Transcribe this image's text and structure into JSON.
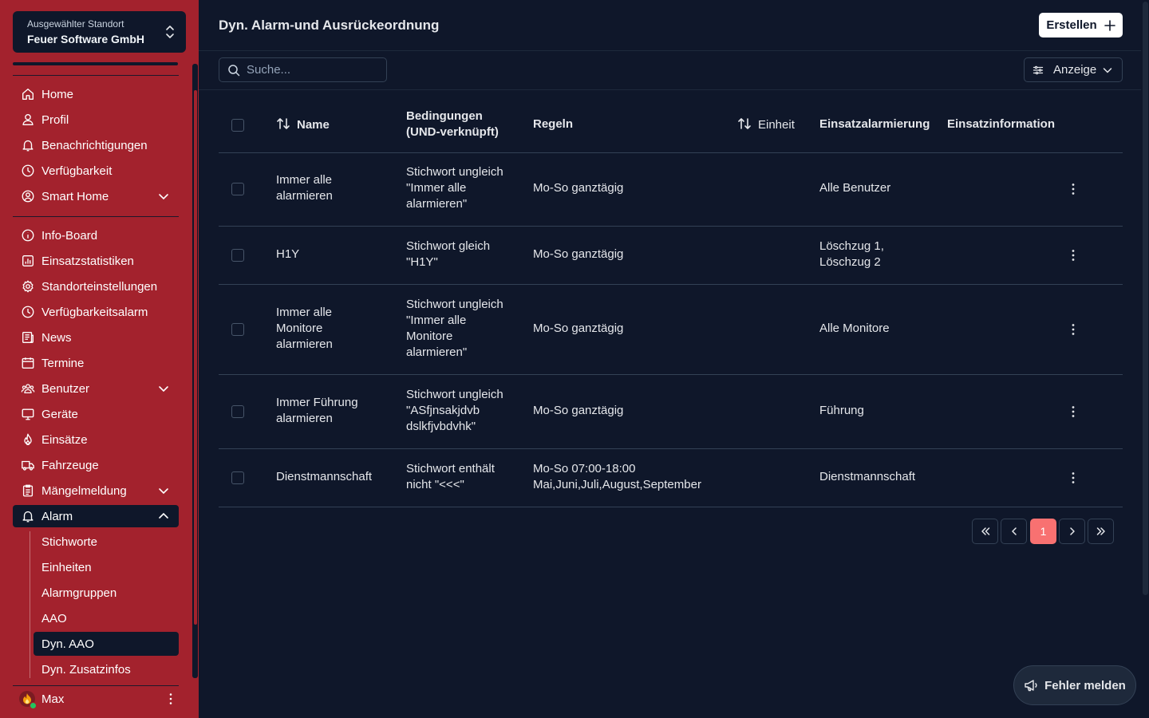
{
  "location": {
    "label": "Ausgewählter Standort",
    "value": "Feuer Software GmbH"
  },
  "nav_primary": [
    {
      "label": "Home",
      "icon": "home-icon"
    },
    {
      "label": "Profil",
      "icon": "user-icon"
    },
    {
      "label": "Benachrichtigungen",
      "icon": "bell-icon"
    },
    {
      "label": "Verfügbarkeit",
      "icon": "clock-icon"
    },
    {
      "label": "Smart Home",
      "icon": "user-circle-icon"
    }
  ],
  "nav_secondary": [
    {
      "label": "Info-Board",
      "icon": "info-icon"
    },
    {
      "label": "Einsatzstatistiken",
      "icon": "chart-icon"
    },
    {
      "label": "Standorteinstellungen",
      "icon": "gear-icon"
    },
    {
      "label": "Verfügbarkeitsalarm",
      "icon": "clock-icon"
    },
    {
      "label": "News",
      "icon": "newspaper-icon"
    },
    {
      "label": "Termine",
      "icon": "calendar-icon"
    },
    {
      "label": "Benutzer",
      "icon": "users-icon"
    },
    {
      "label": "Geräte",
      "icon": "monitor-icon"
    },
    {
      "label": "Einsätze",
      "icon": "flame-icon"
    },
    {
      "label": "Fahrzeuge",
      "icon": "truck-icon"
    },
    {
      "label": "Mängelmeldung",
      "icon": "clipboard-icon"
    },
    {
      "label": "Alarm",
      "icon": "bell-icon"
    }
  ],
  "alarm_sub": [
    "Stichworte",
    "Einheiten",
    "Alarmgruppen",
    "AAO",
    "Dyn. AAO",
    "Dyn. Zusatzinfos"
  ],
  "user": {
    "name": "Max"
  },
  "page": {
    "title": "Dyn. Alarm-und Ausrückeordnung",
    "create_label": "Erstellen",
    "search_placeholder": "Suche...",
    "view_label": "Anzeige"
  },
  "table": {
    "headers": {
      "name": "Name",
      "conditions_1": "Bedingungen",
      "conditions_2": "(UND-verknüpft)",
      "rules": "Regeln",
      "unit": "Einheit",
      "alarming": "Einsatzalarmierung",
      "info": "Einsatzinformation"
    },
    "rows": [
      {
        "name": [
          "Immer alle",
          "alarmieren"
        ],
        "conditions": [
          "Stichwort ungleich",
          "\"Immer alle",
          "alarmieren\""
        ],
        "rules": [
          "Mo-So ganztägig"
        ],
        "alarming": [
          "Alle Benutzer"
        ]
      },
      {
        "name": [
          "H1Y"
        ],
        "conditions": [
          "Stichwort gleich",
          "\"H1Y\""
        ],
        "rules": [
          "Mo-So ganztägig"
        ],
        "alarming": [
          "Löschzug 1,",
          "Löschzug 2"
        ]
      },
      {
        "name": [
          "Immer alle",
          "Monitore",
          "alarmieren"
        ],
        "conditions": [
          "Stichwort ungleich",
          "\"Immer alle",
          "Monitore",
          "alarmieren\""
        ],
        "rules": [
          "Mo-So ganztägig"
        ],
        "alarming": [
          "Alle Monitore"
        ]
      },
      {
        "name": [
          "Immer Führung",
          "alarmieren"
        ],
        "conditions": [
          "Stichwort ungleich",
          "\"ASfjnsakjdvb",
          "dslkfjvbdvhk\""
        ],
        "rules": [
          "Mo-So ganztägig"
        ],
        "alarming": [
          "Führung"
        ]
      },
      {
        "name": [
          "Dienstmannschaft"
        ],
        "conditions": [
          "Stichwort enthält",
          "nicht \"<<<\""
        ],
        "rules": [
          "Mo-So 07:00-18:00",
          "Mai,Juni,Juli,August,September"
        ],
        "alarming": [
          "Dienstmannschaft"
        ]
      }
    ]
  },
  "pagination": {
    "current": "1"
  },
  "report_label": "Fehler melden",
  "colors": {
    "sidebar": "#a3222d",
    "background": "#0f172a",
    "accent": "#f87171"
  }
}
